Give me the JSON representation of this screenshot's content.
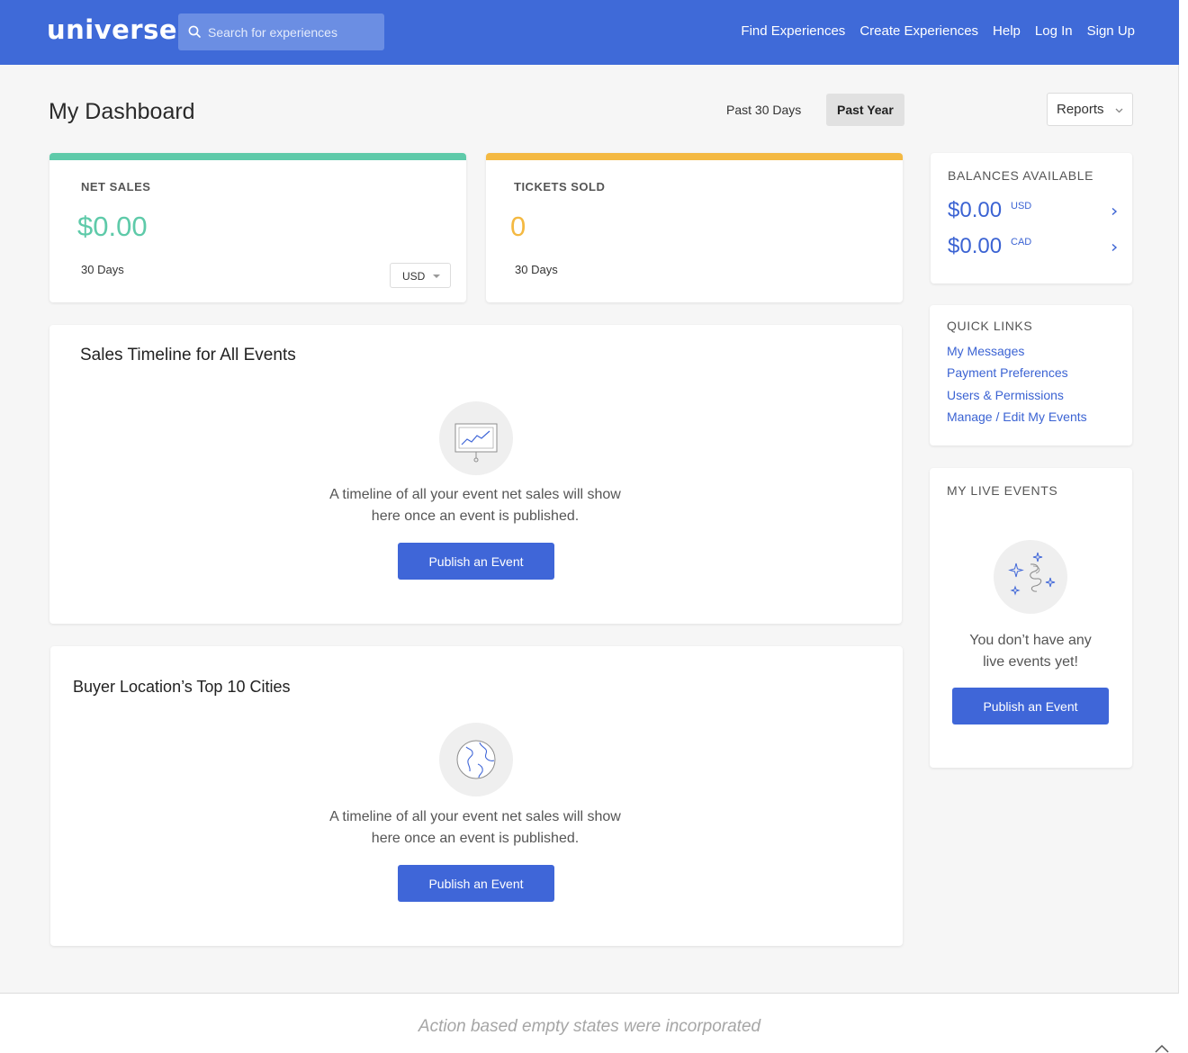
{
  "header": {
    "logo": "universe",
    "search_placeholder": "Search for experiences",
    "nav": [
      "Find Experiences",
      "Create Experiences",
      "Help",
      "Log In",
      "Sign Up"
    ]
  },
  "dashboard": {
    "title": "My Dashboard",
    "ranges": [
      "Past 30 Days",
      "Past Year"
    ],
    "selected_range": "Past Year",
    "reports_label": "Reports"
  },
  "stats": {
    "net_sales": {
      "label": "NET SALES",
      "value": "$0.00",
      "period": "30 Days",
      "currency": "USD",
      "accent": "#5ecaa9"
    },
    "tickets_sold": {
      "label": "TICKETS SOLD",
      "value": "0",
      "period": "30 Days",
      "accent": "#f4b942"
    }
  },
  "timeline": {
    "title": "Sales Timeline for All Events",
    "message": "A timeline of all your event net sales will show here once an event is published.",
    "button": "Publish an Event",
    "icon": "chart-board-icon"
  },
  "cities": {
    "title": "Buyer Location’s Top 10 Cities",
    "message": "A timeline of all your event net sales will show here once an event is published.",
    "button": "Publish an Event",
    "icon": "globe-icon"
  },
  "balances": {
    "title": "BALANCES AVAILABLE",
    "items": [
      {
        "amount": "$0.00",
        "currency": "USD"
      },
      {
        "amount": "$0.00",
        "currency": "CAD"
      }
    ]
  },
  "quick_links": {
    "title": "QUICK LINKS",
    "items": [
      "My Messages",
      "Payment Preferences",
      "Users & Permissions",
      "Manage / Edit My Events"
    ]
  },
  "live_events": {
    "title": "MY LIVE EVENTS",
    "message": "You don’t have any live events yet!",
    "button": "Publish an Event",
    "icon": "confetti-sparkle-icon"
  },
  "caption": "Action based empty states were incorporated",
  "colors": {
    "brand": "#3f6ad8",
    "button": "#3f66d8",
    "link": "#3b63d3"
  }
}
